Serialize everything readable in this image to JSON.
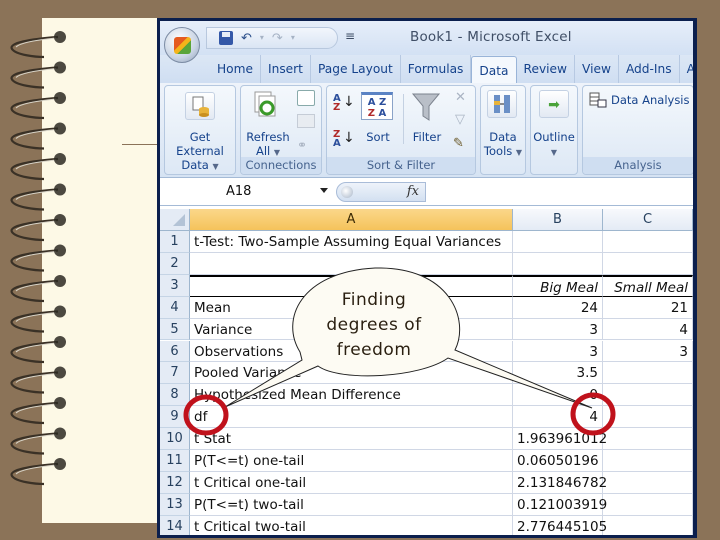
{
  "window": {
    "title": "Book1 - Microsoft Excel",
    "quick_access": [
      "save-icon",
      "undo-icon",
      "redo-icon"
    ],
    "tabs": [
      {
        "label": "Home",
        "active": false
      },
      {
        "label": "Insert",
        "active": false
      },
      {
        "label": "Page Layout",
        "active": false
      },
      {
        "label": "Formulas",
        "active": false
      },
      {
        "label": "Data",
        "active": true
      },
      {
        "label": "Review",
        "active": false
      },
      {
        "label": "View",
        "active": false
      },
      {
        "label": "Add-Ins",
        "active": false
      },
      {
        "label": "Acrob",
        "active": false
      }
    ]
  },
  "ribbon": {
    "get_external_data": {
      "line1": "Get External",
      "line2": "Data"
    },
    "connections": {
      "refresh_line1": "Refresh",
      "refresh_line2": "All",
      "group_label": "Connections"
    },
    "sort_filter": {
      "sort": "Sort",
      "filter": "Filter",
      "group_label": "Sort & Filter"
    },
    "data_tools": {
      "line1": "Data",
      "line2": "Tools"
    },
    "outline": {
      "label": "Outline"
    },
    "analysis": {
      "data_analysis": "Data Analysis",
      "group_label": "Analysis"
    }
  },
  "formula_bar": {
    "name_box": "A18",
    "fx": "fx",
    "formula": ""
  },
  "sheet": {
    "columns": [
      "A",
      "B",
      "C"
    ],
    "selected_column": "A",
    "rows": [
      {
        "n": "1",
        "a": "t-Test: Two-Sample Assuming Equal Variances",
        "b": "",
        "c": ""
      },
      {
        "n": "2",
        "a": "",
        "b": "",
        "c": ""
      },
      {
        "n": "3",
        "a": "",
        "b": "Big Meal",
        "c": "Small Meal"
      },
      {
        "n": "4",
        "a": "Mean",
        "b": "24",
        "c": "21"
      },
      {
        "n": "5",
        "a": "Variance",
        "b": "3",
        "c": "4"
      },
      {
        "n": "6",
        "a": "Observations",
        "b": "3",
        "c": "3"
      },
      {
        "n": "7",
        "a": "Pooled Variance",
        "b": "3.5",
        "c": ""
      },
      {
        "n": "8",
        "a": "Hypothesized Mean Difference",
        "b": "0",
        "c": ""
      },
      {
        "n": "9",
        "a": "df",
        "b": "4",
        "c": ""
      },
      {
        "n": "10",
        "a": "t Stat",
        "b": "1.963961012",
        "c": ""
      },
      {
        "n": "11",
        "a": "P(T<=t) one-tail",
        "b": "0.06050196",
        "c": ""
      },
      {
        "n": "12",
        "a": "t Critical one-tail",
        "b": "2.131846782",
        "c": ""
      },
      {
        "n": "13",
        "a": "P(T<=t) two-tail",
        "b": "0.121003919",
        "c": ""
      },
      {
        "n": "14",
        "a": "t Critical two-tail",
        "b": "2.776445105",
        "c": ""
      }
    ]
  },
  "annotation": {
    "callout_lines": [
      "Finding",
      "degrees of",
      "freedom"
    ],
    "highlight_color": "#c0121c",
    "highlighted_cells": [
      "A9",
      "B9"
    ]
  },
  "colors": {
    "background": "#8b7358",
    "paper": "#fdf9e6",
    "window_frame": "#0b1f4d",
    "selected_header": "#f5c35b"
  }
}
